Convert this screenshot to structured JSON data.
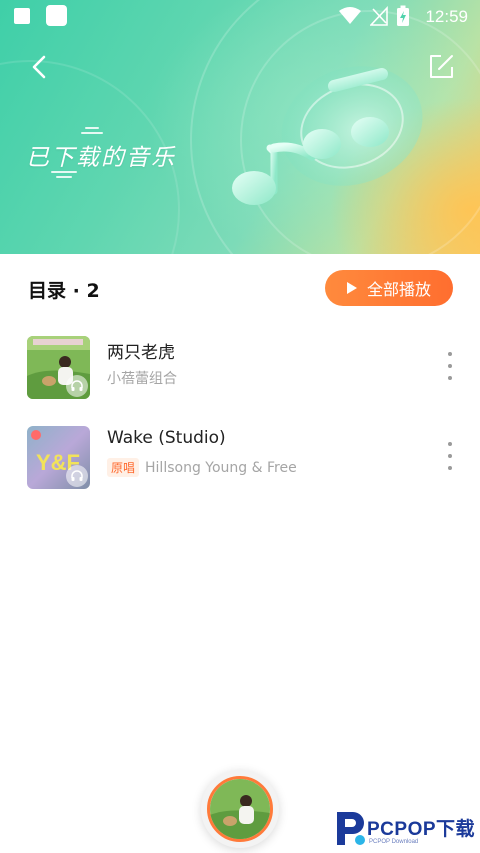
{
  "status_bar": {
    "time": "12:59"
  },
  "header": {
    "title": "已下载的音乐"
  },
  "directory": {
    "label": "目录 · 2",
    "play_all_label": "全部播放"
  },
  "songs": [
    {
      "title": "两只老虎",
      "artist": "小蓓蕾组合",
      "tag": ""
    },
    {
      "title": "Wake (Studio)",
      "artist": "Hillsong Young & Free",
      "tag": "原唱"
    }
  ],
  "watermark": {
    "brand": "PCPOP下载",
    "sub": "PCPOP Download"
  },
  "colors": {
    "accent": "#ff7a3a",
    "hero_green": "#4fd3ac",
    "hero_orange": "#f7cc6a"
  }
}
